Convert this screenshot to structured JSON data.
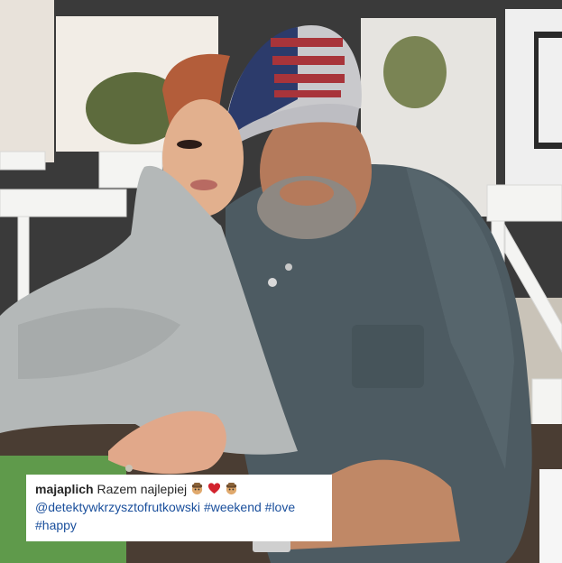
{
  "post": {
    "username": "majaplich",
    "text": "Razem najlepiej",
    "emojis": [
      "detective-emoji",
      "red-heart-emoji",
      "detective-emoji"
    ],
    "mention": "@detektywkrzysztofrutkowski",
    "hashtags": [
      "#weekend",
      "#love",
      "#happy"
    ]
  },
  "colors": {
    "link": "#1a4f9c",
    "text": "#262626",
    "heart": "#d2222d"
  }
}
